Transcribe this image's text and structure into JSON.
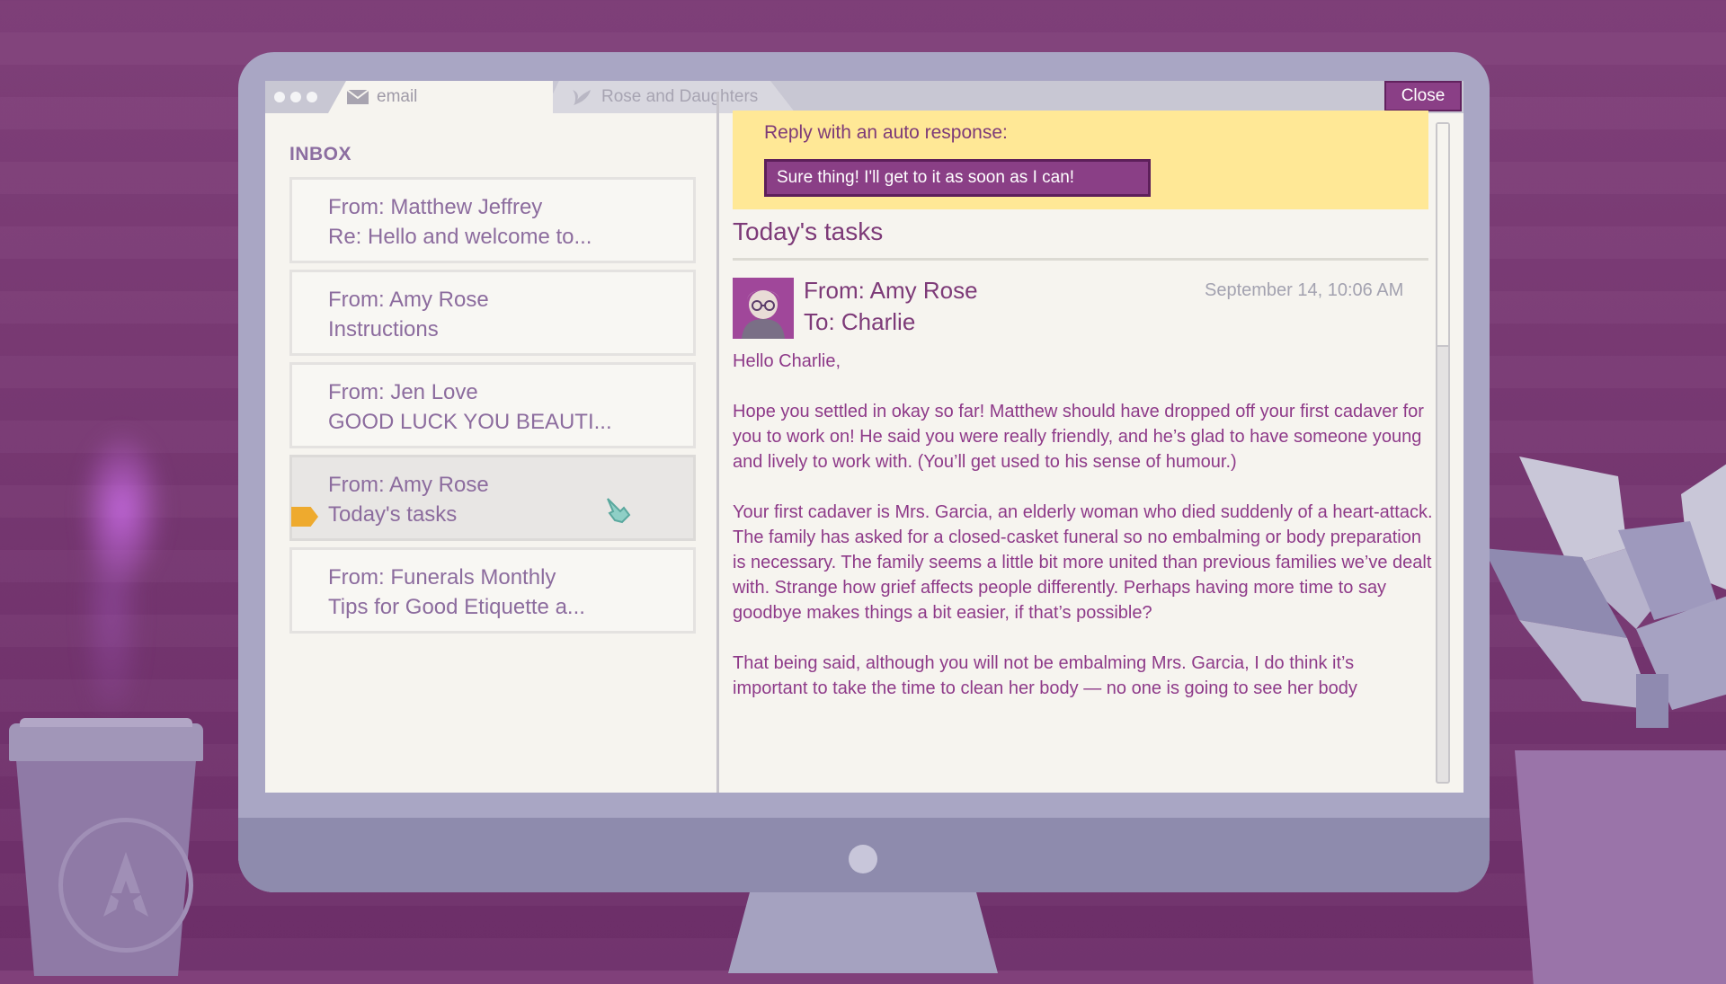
{
  "tabs": {
    "email_label": "email",
    "company_label": "Rose and Daughters"
  },
  "window": {
    "close_label": "Close"
  },
  "inbox": {
    "title": "INBOX",
    "items": [
      {
        "from": "From: Matthew Jeffrey",
        "subject": "Re: Hello and welcome to..."
      },
      {
        "from": "From: Amy Rose",
        "subject": "Instructions"
      },
      {
        "from": "From: Jen Love",
        "subject": "GOOD LUCK YOU BEAUTI..."
      },
      {
        "from": "From: Amy Rose",
        "subject": "Today's tasks"
      },
      {
        "from": "From: Funerals Monthly",
        "subject": "Tips for Good Etiquette a..."
      }
    ]
  },
  "reply": {
    "label": "Reply with an auto response:",
    "button": "Sure thing! I'll get to it as soon as I can!"
  },
  "email": {
    "subject": "Today's tasks",
    "from": "From: Amy Rose",
    "to": "To: Charlie",
    "date": "September 14, 10:06 AM",
    "greeting": "Hello Charlie,",
    "paragraph1": "Hope you settled in okay so far! Matthew should have dropped off your first cadaver for you to work on! He said you were really friendly, and he’s glad to have someone young and lively to work with. (You’ll get used to his sense of humour.)",
    "paragraph2": "Your first cadaver is Mrs. Garcia, an elderly woman who died suddenly of a heart-attack. The family has asked for a closed-casket funeral so no embalming or body preparation is necessary. The family seems a little bit more united than previous families we’ve dealt with. Strange how grief affects people differently. Perhaps having more time to say goodbye makes things a bit easier, if that’s possible?",
    "paragraph3": "That being said, although you will not be embalming Mrs. Garcia, I do think it’s important to take the time to clean her body — no one is going to see her body"
  },
  "colors": {
    "background": "#80407a",
    "accent": "#8a3f86",
    "reply_bg": "#ffe896",
    "tag": "#eeaa2e"
  },
  "icons": [
    "envelope-icon",
    "leaf-icon",
    "hand-cursor-icon",
    "label-tag-icon",
    "star-logo-icon"
  ]
}
